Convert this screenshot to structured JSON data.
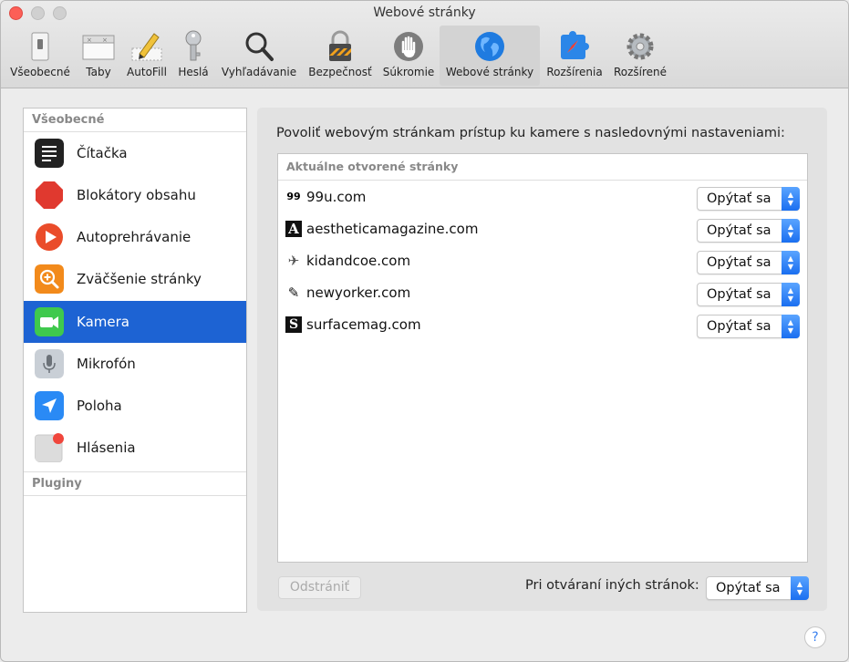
{
  "window": {
    "title": "Webové stránky"
  },
  "toolbar": {
    "items": [
      {
        "label": "Všeobecné",
        "icon": "switch-icon"
      },
      {
        "label": "Taby",
        "icon": "tabs-icon"
      },
      {
        "label": "AutoFill",
        "icon": "pencil-icon"
      },
      {
        "label": "Heslá",
        "icon": "key-icon"
      },
      {
        "label": "Vyhľadávanie",
        "icon": "magnifier-icon"
      },
      {
        "label": "Bezpečnosť",
        "icon": "padlock-icon"
      },
      {
        "label": "Súkromie",
        "icon": "hand-icon"
      },
      {
        "label": "Webové stránky",
        "icon": "globe-icon",
        "active": true
      },
      {
        "label": "Rozšírenia",
        "icon": "puzzle-compass-icon"
      },
      {
        "label": "Rozšírené",
        "icon": "gear-icon"
      }
    ]
  },
  "sidebar": {
    "general_header": "Všeobecné",
    "plugins_header": "Pluginy",
    "items": [
      {
        "label": "Čítačka",
        "icon": "reader-icon",
        "color": "#222222"
      },
      {
        "label": "Blokátory obsahu",
        "icon": "stop-sign-icon",
        "color": "#e0392f"
      },
      {
        "label": "Autoprehrávanie",
        "icon": "play-icon",
        "color": "#ea4c2a"
      },
      {
        "label": "Zväčšenie stránky",
        "icon": "zoom-icon",
        "color": "#f28a1b"
      },
      {
        "label": "Kamera",
        "icon": "camera-icon",
        "color": "#3fc94d",
        "selected": true
      },
      {
        "label": "Mikrofón",
        "icon": "microphone-icon",
        "color": "#c9cfd6"
      },
      {
        "label": "Poloha",
        "icon": "location-arrow-icon",
        "color": "#2a8af5"
      },
      {
        "label": "Hlásenia",
        "icon": "notification-icon",
        "color": "#d8d8d8"
      }
    ]
  },
  "main": {
    "description": "Povoliť webovým stránkam prístup ku kamere s nasledovnými nastaveniami:",
    "sites_header": "Aktuálne otvorené stránky",
    "sites": [
      {
        "name": "99u.com",
        "favicon": "99",
        "setting": "Opýtať sa"
      },
      {
        "name": "aestheticamagazine.com",
        "favicon": "A",
        "setting": "Opýtať sa"
      },
      {
        "name": "kidandcoe.com",
        "favicon": "✈",
        "setting": "Opýtať sa"
      },
      {
        "name": "newyorker.com",
        "favicon": "✎",
        "setting": "Opýtať sa"
      },
      {
        "name": "surfacemag.com",
        "favicon": "S",
        "setting": "Opýtať sa"
      }
    ],
    "remove_button": "Odstrániť",
    "other_sites_label": "Pri otváraní iných stránok:",
    "other_sites_value": "Opýtať sa",
    "help": "?"
  },
  "colors": {
    "accent": "#1d63d3",
    "popup_arrow": "#2a7cf5"
  }
}
